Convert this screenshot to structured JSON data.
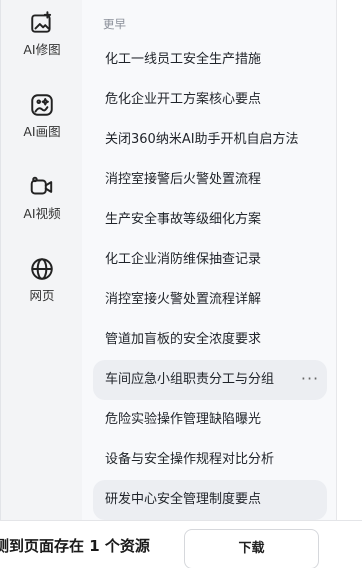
{
  "sidebar": {
    "items": [
      {
        "label": "AI修图",
        "icon": "image-edit-icon"
      },
      {
        "label": "AI画图",
        "icon": "image-sparkle-icon"
      },
      {
        "label": "AI视频",
        "icon": "video-camera-icon"
      },
      {
        "label": "网页",
        "icon": "globe-icon"
      }
    ]
  },
  "history": {
    "section_label": "更早",
    "items": [
      "化工一线员工安全生产措施",
      "危化企业开工方案核心要点",
      "关闭360纳米AI助手开机自启方法",
      "消控室接警后火警处置流程",
      "生产安全事故等级细化方案",
      "化工企业消防维保抽查记录",
      "消控室接火警处置流程详解",
      "管道加盲板的安全浓度要求",
      "车间应急小组职责分工与分组",
      "危险实验操作管理缺陷曝光",
      "设备与安全操作规程对比分析",
      "研发中心安全管理制度要点"
    ],
    "more_glyph": "···"
  },
  "bottom_bar": {
    "resource_text": "测到页面存在 1 个资源",
    "download_label": "下载"
  }
}
